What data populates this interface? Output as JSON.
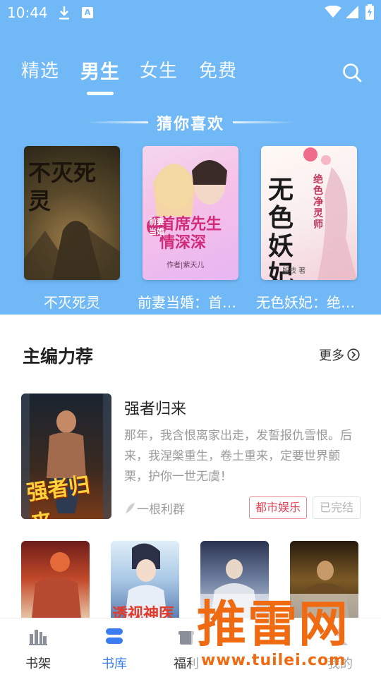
{
  "status_bar": {
    "time": "10:44",
    "a_badge": "A",
    "icons": [
      "download-icon",
      "a-icon",
      "wifi-icon",
      "signal-icon",
      "battery-icon"
    ]
  },
  "tabs": [
    {
      "label": "精选",
      "active": false
    },
    {
      "label": "男生",
      "active": true
    },
    {
      "label": "女生",
      "active": false
    },
    {
      "label": "免费",
      "active": false
    }
  ],
  "guess_section": {
    "title": "猜你喜欢",
    "books": [
      {
        "title": "不灭死灵",
        "cover_text": "不灭死灵"
      },
      {
        "title": "前妻当婚：首席先生情深深",
        "cover_text": "首席先生情深深",
        "cover_small": "前妻当婚",
        "cover_author": "作者|紫天儿"
      },
      {
        "title": "无色妖妃：绝色净灵师",
        "cover_text": "无色妖妃",
        "cover_small": "绝色净灵师",
        "cover_author": "殷枝 著"
      }
    ]
  },
  "editor_section": {
    "title": "主编力荐",
    "more_label": "更多",
    "featured": {
      "title": "强者归来",
      "cover_text": "强者归来",
      "description": "那年，我含恨离家出走，发誓报仇雪恨。后来，我涅槃重生，卷土重来，定要世界颤栗，护你一世无虞！",
      "author": "一根利群",
      "genre_tag": "都市娱乐",
      "status_tag": "已完结"
    },
    "row_books": [
      {
        "cover_text": ""
      },
      {
        "cover_text": "透视神医"
      },
      {
        "cover_text": ""
      },
      {
        "cover_text": ""
      }
    ]
  },
  "bottom_nav": [
    {
      "label": "书架",
      "icon": "bookshelf-icon",
      "active": false
    },
    {
      "label": "书库",
      "icon": "library-icon",
      "active": true
    },
    {
      "label": "福利",
      "icon": "gift-icon",
      "active": false
    },
    {
      "label": "我的",
      "icon": "profile-icon",
      "active": false
    }
  ],
  "watermark": {
    "big": "推雷网",
    "url": "www.tuilei.com"
  },
  "colors": {
    "header_blue": "#70b8f6",
    "accent_blue": "#3b7cf0",
    "tag_red": "#e0465a",
    "watermark_orange": "#f06a12"
  }
}
